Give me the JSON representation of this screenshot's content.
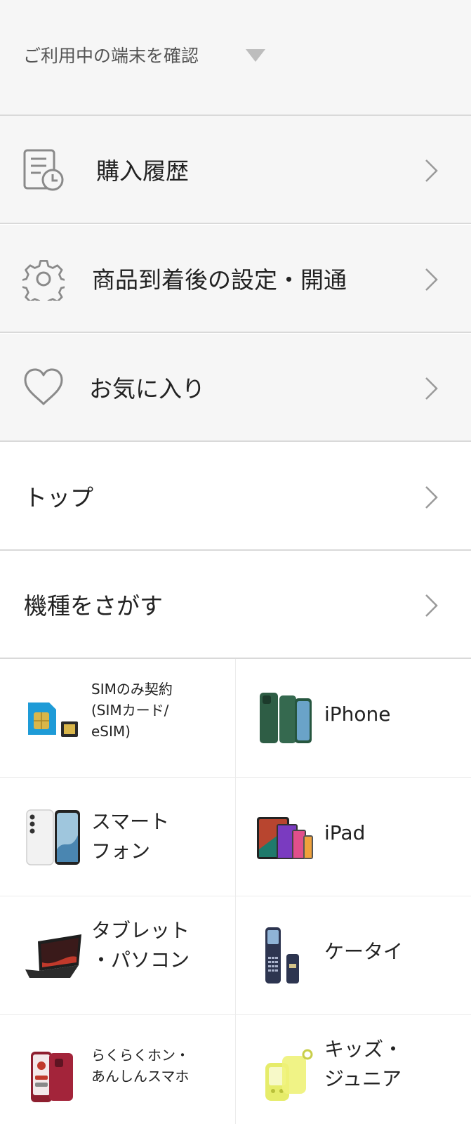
{
  "device_check": {
    "label": "ご利用中の端末を確認"
  },
  "menu": {
    "purchase_history": "購入履歴",
    "setup": "商品到着後の設定・開通",
    "favorites": "お気に入り",
    "top": "トップ",
    "find_device": "機種をさがす"
  },
  "categories": {
    "sim": {
      "line1": "SIMのみ契約",
      "line2": "(SIMカード/",
      "line3": "eSIM)"
    },
    "iphone": {
      "label": "iPhone"
    },
    "smartphone": {
      "line1": "スマート",
      "line2": "フォン"
    },
    "ipad": {
      "label": "iPad"
    },
    "tablet": {
      "line1": "タブレット",
      "line2": "・パソコン"
    },
    "keitai": {
      "label": "ケータイ"
    },
    "raku": {
      "line1": "らくらくホン・",
      "line2": "あんしんスマホ"
    },
    "kids": {
      "line1": "キッズ・",
      "line2": "ジュニア"
    }
  },
  "colors": {
    "grey_bg": "#f6f6f6",
    "divider": "#d9d9d9",
    "icon_stroke": "#8a8a8a"
  }
}
